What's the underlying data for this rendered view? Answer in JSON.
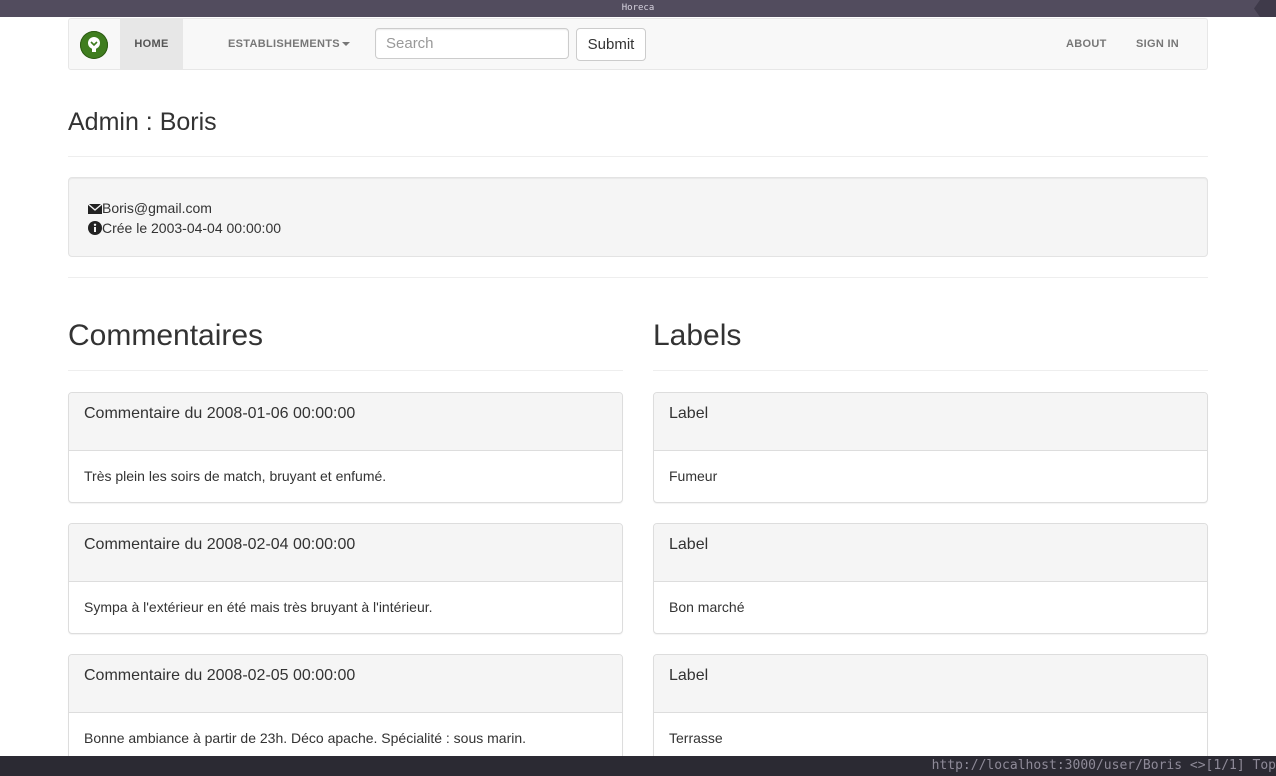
{
  "window": {
    "title": "Horeca"
  },
  "navbar": {
    "home": "HOME",
    "establishments": "ESTABLISHEMENTS",
    "search_placeholder": "Search",
    "submit": "Submit",
    "about": "ABOUT",
    "sign_in": "SIGN IN"
  },
  "page": {
    "title": "Admin : Boris"
  },
  "profile": {
    "email": "Boris@gmail.com",
    "created": "Crée le 2003-04-04 00:00:00"
  },
  "comments": {
    "heading": "Commentaires",
    "items": [
      {
        "title": "Commentaire du 2008-01-06 00:00:00",
        "body": "Très plein les soirs de match, bruyant et enfumé."
      },
      {
        "title": "Commentaire du 2008-02-04 00:00:00",
        "body": "Sympa à l'extérieur en été mais très bruyant à l'intérieur."
      },
      {
        "title": "Commentaire du 2008-02-05 00:00:00",
        "body": "Bonne ambiance à partir de 23h. Déco apache. Spécialité : sous marin."
      }
    ]
  },
  "labels": {
    "heading": "Labels",
    "items": [
      {
        "title": "Label",
        "body": "Fumeur"
      },
      {
        "title": "Label",
        "body": "Bon marché"
      },
      {
        "title": "Label",
        "body": "Terrasse"
      }
    ]
  },
  "statusbar": {
    "url": "http://localhost:3000/user/Boris",
    "indicator": "<>[1/1]",
    "position": "Top"
  }
}
